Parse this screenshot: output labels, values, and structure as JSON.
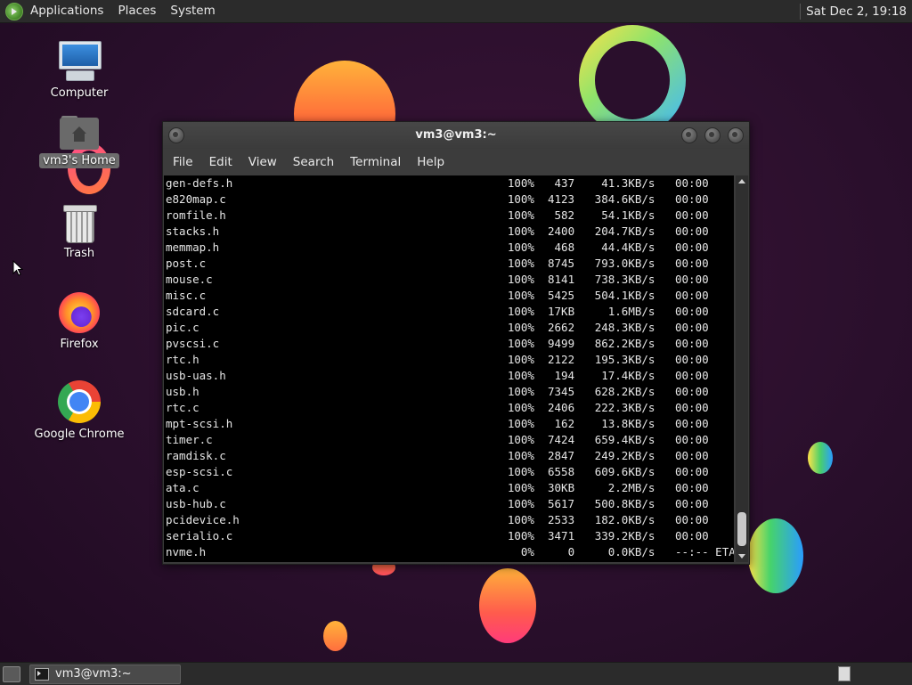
{
  "top_panel": {
    "menus": [
      "Applications",
      "Places",
      "System"
    ],
    "clock": "Sat Dec 2, 19:18"
  },
  "desktop_icons": [
    {
      "label": "Computer",
      "icon": "computer-icon"
    },
    {
      "label": "vm3's Home",
      "icon": "home-folder-icon",
      "selected": true
    },
    {
      "label": "Trash",
      "icon": "trash-icon"
    },
    {
      "label": "Firefox",
      "icon": "firefox-icon"
    },
    {
      "label": "Google Chrome",
      "icon": "chrome-icon"
    }
  ],
  "terminal": {
    "title": "vm3@vm3:~",
    "menu": [
      "File",
      "Edit",
      "View",
      "Search",
      "Terminal",
      "Help"
    ],
    "lines": [
      {
        "file": "gen-defs.h",
        "pct": "100%",
        "size": "437",
        "rate": "41.3KB/s",
        "time": "00:00"
      },
      {
        "file": "e820map.c",
        "pct": "100%",
        "size": "4123",
        "rate": "384.6KB/s",
        "time": "00:00"
      },
      {
        "file": "romfile.h",
        "pct": "100%",
        "size": "582",
        "rate": "54.1KB/s",
        "time": "00:00"
      },
      {
        "file": "stacks.h",
        "pct": "100%",
        "size": "2400",
        "rate": "204.7KB/s",
        "time": "00:00"
      },
      {
        "file": "memmap.h",
        "pct": "100%",
        "size": "468",
        "rate": "44.4KB/s",
        "time": "00:00"
      },
      {
        "file": "post.c",
        "pct": "100%",
        "size": "8745",
        "rate": "793.0KB/s",
        "time": "00:00"
      },
      {
        "file": "mouse.c",
        "pct": "100%",
        "size": "8141",
        "rate": "738.3KB/s",
        "time": "00:00"
      },
      {
        "file": "misc.c",
        "pct": "100%",
        "size": "5425",
        "rate": "504.1KB/s",
        "time": "00:00"
      },
      {
        "file": "sdcard.c",
        "pct": "100%",
        "size": "17KB",
        "rate": "1.6MB/s",
        "time": "00:00"
      },
      {
        "file": "pic.c",
        "pct": "100%",
        "size": "2662",
        "rate": "248.3KB/s",
        "time": "00:00"
      },
      {
        "file": "pvscsi.c",
        "pct": "100%",
        "size": "9499",
        "rate": "862.2KB/s",
        "time": "00:00"
      },
      {
        "file": "rtc.h",
        "pct": "100%",
        "size": "2122",
        "rate": "195.3KB/s",
        "time": "00:00"
      },
      {
        "file": "usb-uas.h",
        "pct": "100%",
        "size": "194",
        "rate": "17.4KB/s",
        "time": "00:00"
      },
      {
        "file": "usb.h",
        "pct": "100%",
        "size": "7345",
        "rate": "628.2KB/s",
        "time": "00:00"
      },
      {
        "file": "rtc.c",
        "pct": "100%",
        "size": "2406",
        "rate": "222.3KB/s",
        "time": "00:00"
      },
      {
        "file": "mpt-scsi.h",
        "pct": "100%",
        "size": "162",
        "rate": "13.8KB/s",
        "time": "00:00"
      },
      {
        "file": "timer.c",
        "pct": "100%",
        "size": "7424",
        "rate": "659.4KB/s",
        "time": "00:00"
      },
      {
        "file": "ramdisk.c",
        "pct": "100%",
        "size": "2847",
        "rate": "249.2KB/s",
        "time": "00:00"
      },
      {
        "file": "esp-scsi.c",
        "pct": "100%",
        "size": "6558",
        "rate": "609.6KB/s",
        "time": "00:00"
      },
      {
        "file": "ata.c",
        "pct": "100%",
        "size": "30KB",
        "rate": "2.2MB/s",
        "time": "00:00"
      },
      {
        "file": "usb-hub.c",
        "pct": "100%",
        "size": "5617",
        "rate": "500.8KB/s",
        "time": "00:00"
      },
      {
        "file": "pcidevice.h",
        "pct": "100%",
        "size": "2533",
        "rate": "182.0KB/s",
        "time": "00:00"
      },
      {
        "file": "serialio.c",
        "pct": "100%",
        "size": "3471",
        "rate": "339.2KB/s",
        "time": "00:00"
      },
      {
        "file": "nvme.h",
        "pct": "0%",
        "size": "0",
        "rate": "0.0KB/s",
        "time": "--:-- ETA",
        "cursor": true
      }
    ]
  },
  "taskbar": {
    "window_button": "vm3@vm3:~"
  }
}
